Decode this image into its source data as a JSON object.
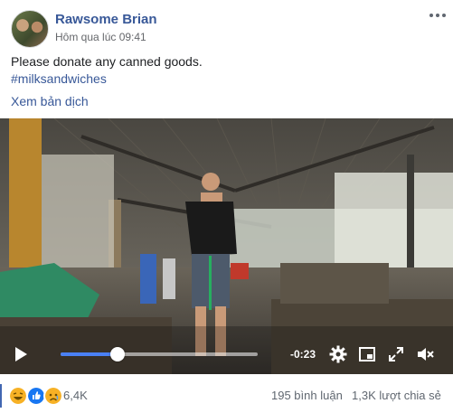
{
  "post": {
    "author": "Rawsome Brian",
    "timestamp": "Hôm qua lúc 09:41",
    "more_icon": "ellipsis-icon",
    "text": "Please donate any canned goods.",
    "hashtag": "#milksandwiches",
    "translate_label": "Xem bản dịch"
  },
  "video": {
    "progress": 0.29,
    "time_remaining": "-0:23",
    "icons": [
      "play-icon",
      "gear-icon",
      "miniplayer-icon",
      "fullscreen-icon",
      "volume-mute-icon"
    ]
  },
  "footer": {
    "reactions": [
      "haha",
      "like",
      "sad"
    ],
    "reaction_count": "6,4K",
    "comments": "195 bình luận",
    "shares": "1,3K lượt chia sẻ"
  },
  "colors": {
    "link": "#385898",
    "progress": "#4a80f5",
    "like": "#1877f2",
    "haha": "#f7b125"
  }
}
